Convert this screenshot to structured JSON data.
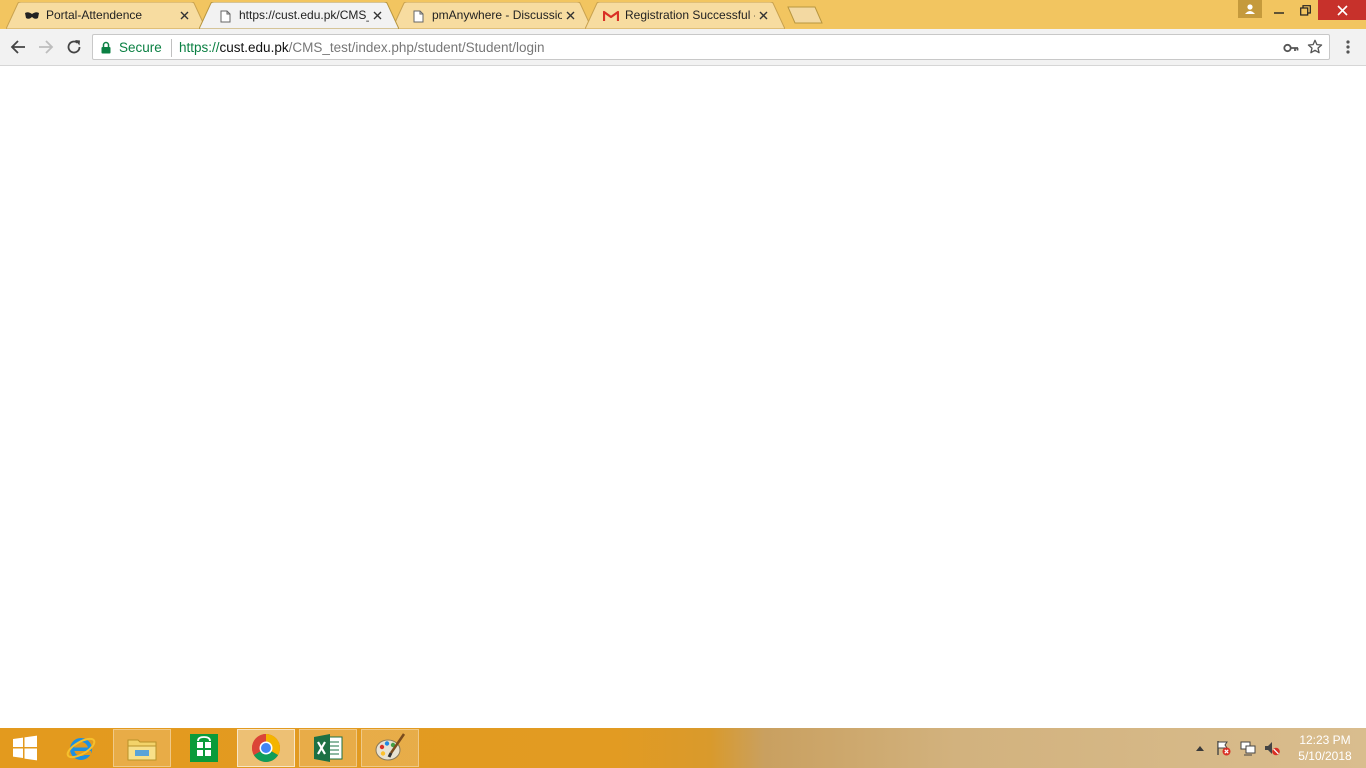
{
  "browser": {
    "tabs": [
      {
        "title": "Portal-Attendence",
        "favicon": "mask-icon",
        "active": false
      },
      {
        "title": "https://cust.edu.pk/CMS_",
        "favicon": "page-icon",
        "active": true
      },
      {
        "title": "pmAnywhere - Discussion",
        "favicon": "page-icon",
        "active": false
      },
      {
        "title": "Registration Successful -",
        "favicon": "gmail-icon",
        "active": false
      }
    ],
    "omnibox": {
      "security_label": "Secure",
      "url_scheme": "https://",
      "url_host": "cust.edu.pk",
      "url_path": "/CMS_test/index.php/student/Student/login"
    }
  },
  "taskbar": {
    "apps": [
      "windows-start-icon",
      "internet-explorer-icon",
      "file-explorer-icon",
      "windows-store-icon",
      "chrome-icon",
      "excel-icon",
      "paint-icon"
    ],
    "clock": {
      "time": "12:23 PM",
      "date": "5/10/2018"
    }
  },
  "colors": {
    "titlebar": "#f2c560",
    "secure_green": "#0b8043",
    "close_red": "#c7312b"
  }
}
